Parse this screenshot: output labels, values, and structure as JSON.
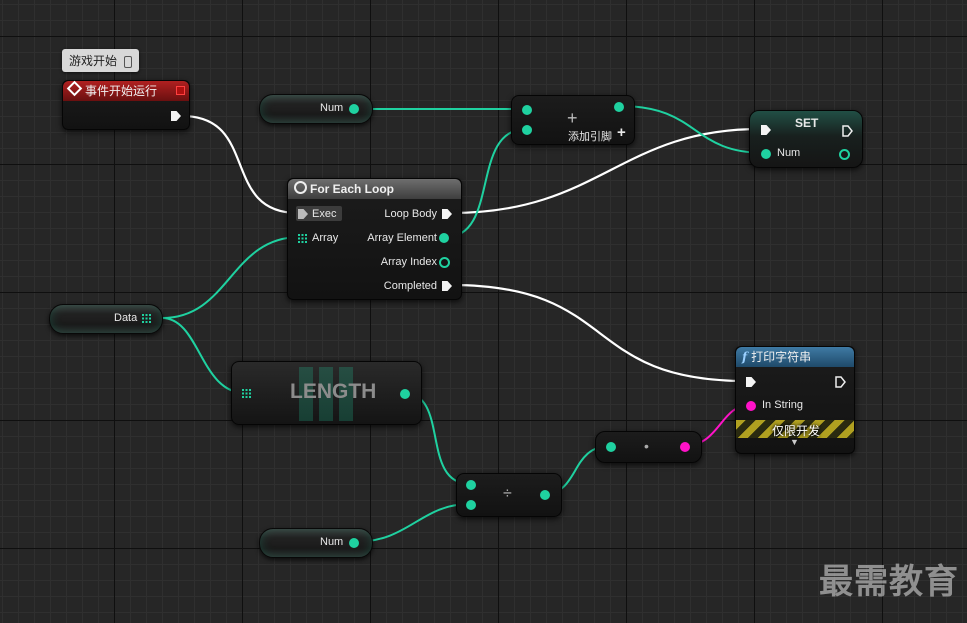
{
  "tooltip": {
    "text": "游戏开始"
  },
  "event_node": {
    "title": "事件开始运行"
  },
  "num_var_top": {
    "label": "Num"
  },
  "num_var_bottom": {
    "label": "Num"
  },
  "data_var": {
    "label": "Data"
  },
  "add_node": {
    "symbol": "+",
    "add_pin_label": "添加引脚",
    "add_pin_symbol": "+"
  },
  "set_node": {
    "title": "SET",
    "pin_label": "Num"
  },
  "foreach_node": {
    "title": "For Each Loop",
    "exec_label": "Exec",
    "array_label": "Array",
    "loop_body_label": "Loop Body",
    "array_element_label": "Array Element",
    "array_index_label": "Array Index",
    "completed_label": "Completed"
  },
  "length_node": {
    "title": "LENGTH"
  },
  "divide_node": {
    "symbol": "÷"
  },
  "convert_node": {
    "symbol": "•"
  },
  "print_node": {
    "title": "打印字符串",
    "function_symbol": "f",
    "in_string_label": "In String",
    "dev_only_label": "仅限开发",
    "expand_symbol": "▼"
  },
  "watermark": {
    "text": "最需教育"
  },
  "colors": {
    "exec_wire": "#ffffff",
    "int_wire": "#1fd1a0",
    "string_wire": "#ff12c8",
    "event_header": "#8e1a1a",
    "foreach_header": "#5a5a5a",
    "print_header": "#2e5a78",
    "set_header": "#1a4a40"
  }
}
